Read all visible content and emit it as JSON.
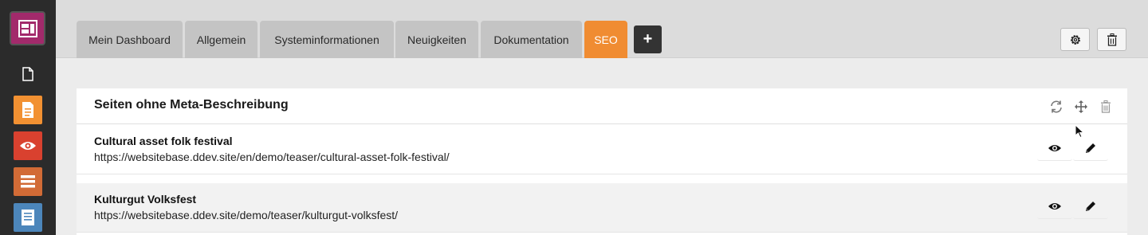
{
  "sidebar": {
    "items": [
      {
        "icon": "dashboard-logo-icon",
        "color": "#a22a6b"
      },
      {
        "icon": "page-icon",
        "color": "#2b2b2b"
      },
      {
        "icon": "document-icon",
        "color": "#f29132"
      },
      {
        "icon": "view-eye-icon",
        "color": "#d9412f"
      },
      {
        "icon": "list-icon",
        "color": "#d26b36"
      },
      {
        "icon": "form-icon",
        "color": "#4c86bb"
      }
    ]
  },
  "tabs": [
    {
      "label": "Mein Dashboard",
      "active": false
    },
    {
      "label": "Allgemein",
      "active": false
    },
    {
      "label": "Systeminformationen",
      "active": false
    },
    {
      "label": "Neuigkeiten",
      "active": false
    },
    {
      "label": "Dokumentation",
      "active": false
    },
    {
      "label": "SEO",
      "active": true
    }
  ],
  "add_tab_label": "+",
  "toolbar": {
    "settings_icon": "gear-icon",
    "delete_icon": "trash-icon"
  },
  "widget": {
    "title": "Seiten ohne Meta-Beschreibung",
    "header_icons": [
      "refresh-icon",
      "move-icon",
      "trash-icon"
    ],
    "rows": [
      {
        "title": "Cultural asset folk festival",
        "url": "https://websitebase.ddev.site/en/demo/teaser/cultural-asset-folk-festival/"
      },
      {
        "title": "Kulturgut Volksfest",
        "url": "https://websitebase.ddev.site/demo/teaser/kulturgut-volksfest/"
      }
    ]
  },
  "colors": {
    "accent": "#f08c32",
    "sidebar": "#2b2b2b"
  }
}
